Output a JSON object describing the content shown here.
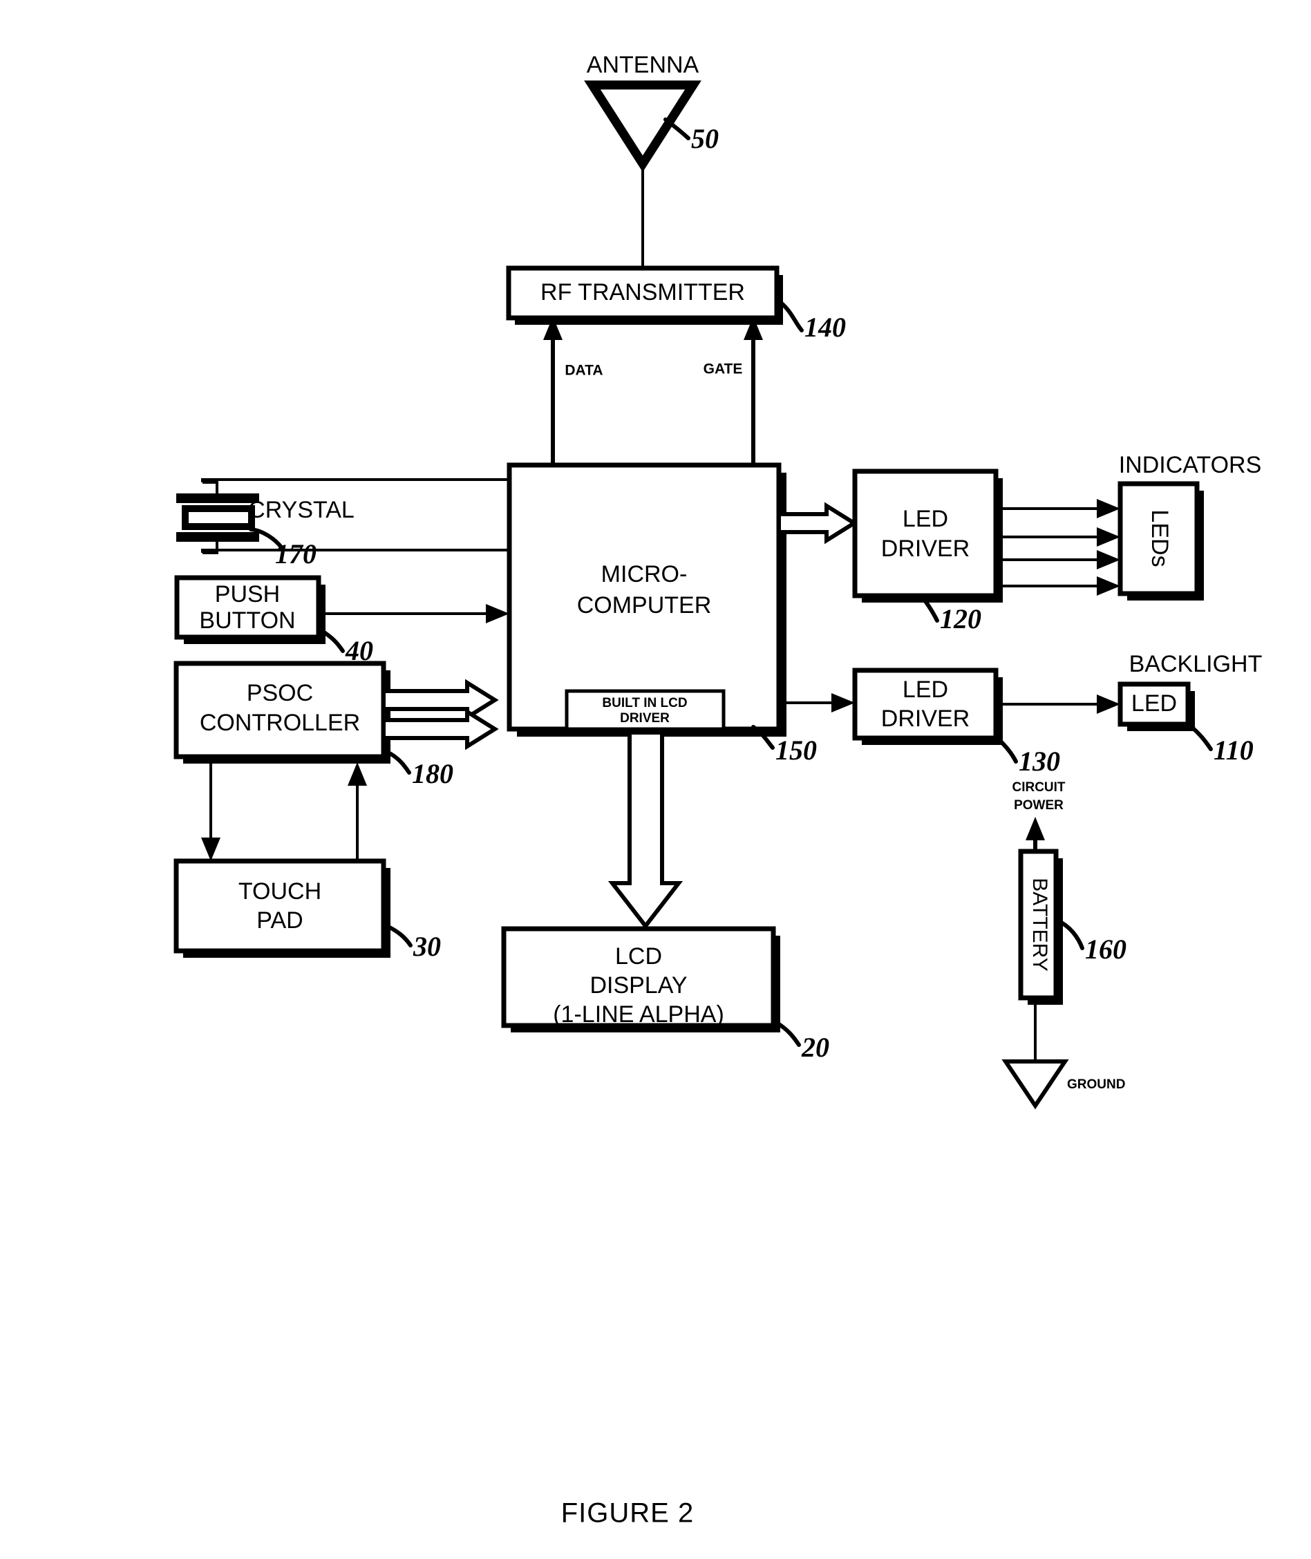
{
  "figure": {
    "caption": "FIGURE 2"
  },
  "blocks": {
    "antenna": {
      "label": "ANTENNA",
      "ref": "50",
      "icon": "antenna-triangle-icon"
    },
    "rf_transmitter": {
      "label": "RF TRANSMITTER",
      "ref": "140"
    },
    "microcomputer": {
      "label_line1": "MICRO-",
      "label_line2": "COMPUTER",
      "ref": "150"
    },
    "built_in_lcd_driver": {
      "label_line1": "BUILT IN LCD",
      "label_line2": "DRIVER"
    },
    "crystal": {
      "label": "CRYSTAL",
      "ref": "170",
      "icon": "crystal-oscillator-icon"
    },
    "push_button": {
      "label_line1": "PUSH",
      "label_line2": "BUTTON",
      "ref": "40"
    },
    "psoc_controller": {
      "label_line1": "PSOC",
      "label_line2": "CONTROLLER",
      "ref": "180"
    },
    "touch_pad": {
      "label_line1": "TOUCH",
      "label_line2": "PAD",
      "ref": "30"
    },
    "lcd_display": {
      "label_line1": "LCD",
      "label_line2": "DISPLAY",
      "label_line3": "(1-LINE ALPHA)",
      "ref": "20"
    },
    "led_driver_indicators": {
      "label_line1": "LED",
      "label_line2": "DRIVER",
      "ref": "120"
    },
    "leds": {
      "label": "LEDs",
      "group_label": "INDICATORS"
    },
    "led_driver_backlight": {
      "label_line1": "LED",
      "label_line2": "DRIVER",
      "ref": "130"
    },
    "backlight_led": {
      "label": "LED",
      "group_label": "BACKLIGHT",
      "ref": "110"
    },
    "battery": {
      "label": "BATTERY",
      "ref": "160",
      "power_label_line1": "CIRCUIT",
      "power_label_line2": "POWER",
      "ground_label": "GROUND",
      "ground_icon": "ground-triangle-icon"
    }
  },
  "signals": {
    "data": "DATA",
    "gate": "GATE"
  },
  "colors": {
    "ink": "#000000",
    "paper": "#ffffff"
  }
}
